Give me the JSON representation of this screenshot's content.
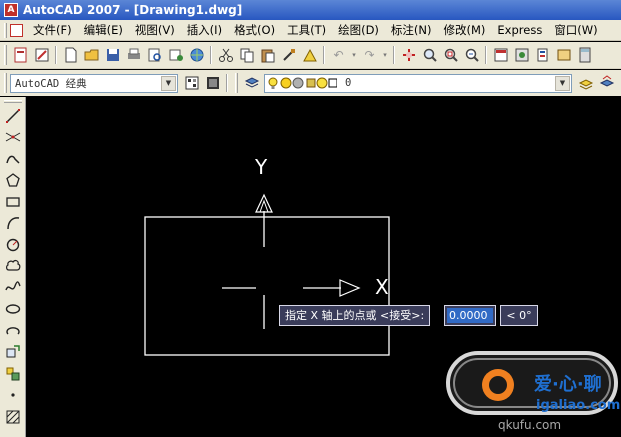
{
  "window": {
    "title": "AutoCAD 2007 - [Drawing1.dwg]"
  },
  "menu": [
    "文件(F)",
    "编辑(E)",
    "视图(V)",
    "插入(I)",
    "格式(O)",
    "工具(T)",
    "绘图(D)",
    "标注(N)",
    "修改(M)",
    "Express",
    "窗口(W)"
  ],
  "workspace": {
    "value": "AutoCAD 经典"
  },
  "layer": {
    "value": "0"
  },
  "drawing": {
    "y_axis_label": "Y",
    "x_axis_label": "X"
  },
  "dynamic_input": {
    "prompt": "指定 X 轴上的点或 <接受>:",
    "value": "0.0000",
    "angle": "< 0°"
  },
  "watermark": {
    "line1": "爱·心·聊",
    "line2": "igaliao.com",
    "line3": "qkufu.com"
  },
  "colors": {
    "canvas": "#000000",
    "chrome": "#ece9d8",
    "titlebar": "#2857c0",
    "tooltip": "#3a3c5a",
    "selection": "#316ac5"
  }
}
